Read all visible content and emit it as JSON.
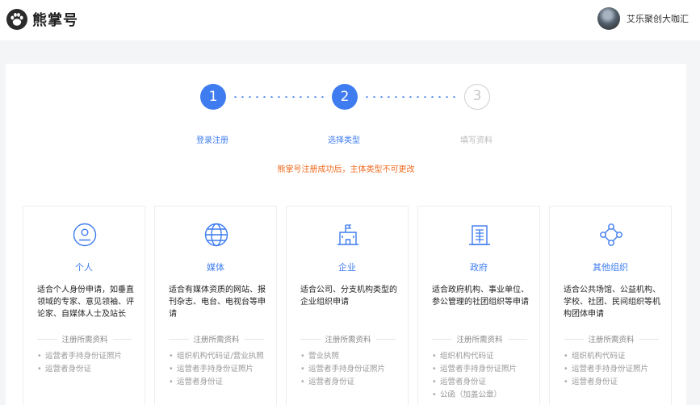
{
  "app": {
    "name": "熊掌号",
    "logo_icon": "bear-paw-icon"
  },
  "user": {
    "name": "艾乐聚创大咖汇"
  },
  "steps": [
    {
      "number": "1",
      "label": "登录注册",
      "state": "done"
    },
    {
      "number": "2",
      "label": "选择类型",
      "state": "current"
    },
    {
      "number": "3",
      "label": "填写资料",
      "state": "pending"
    }
  ],
  "notice": "熊掌号注册成功后，主体类型不可更改",
  "required_heading": "注册所需资料",
  "cards": [
    {
      "icon": "person-icon",
      "title": "个人",
      "desc": "适合个人身份申请，如垂直领域的专家、意见领袖、评论家、自媒体人士及站长",
      "requirements": [
        "运营者手持身份证照片",
        "运营者身份证"
      ]
    },
    {
      "icon": "globe-icon",
      "title": "媒体",
      "desc": "适合有媒体资质的网站、报刊杂志、电台、电视台等申请",
      "requirements": [
        "组织机构代码证/营业执照",
        "运营者手持身份证照片",
        "运营者身份证"
      ]
    },
    {
      "icon": "building-flag-icon",
      "title": "企业",
      "desc": "适合公司、分支机构类型的企业组织申请",
      "requirements": [
        "营业执照",
        "运营者手持身份证照片",
        "运营者身份证"
      ]
    },
    {
      "icon": "government-building-icon",
      "title": "政府",
      "desc": "适合政府机构、事业单位、参公管理的社团组织等申请",
      "requirements": [
        "组织机构代码证",
        "运营者手持身份证照片",
        "运营者身份证",
        "公函（加盖公章）"
      ]
    },
    {
      "icon": "network-nodes-icon",
      "title": "其他组织",
      "desc": "适合公共场馆、公益机构、学校、社团、民间组织等机构团体申请",
      "requirements": [
        "组织机构代码证",
        "运营者手持身份证照片",
        "运营者身份证"
      ]
    }
  ],
  "colors": {
    "accent": "#3e7cf0",
    "notice": "#f0691e"
  }
}
